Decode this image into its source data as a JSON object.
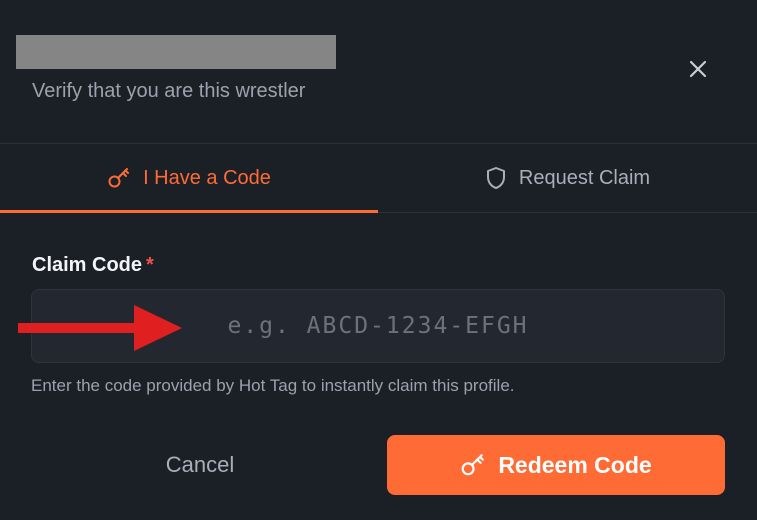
{
  "dialog": {
    "subtitle": "Verify that you are this wrestler",
    "close_icon": "close-icon"
  },
  "tabs": [
    {
      "label": "I Have a Code",
      "icon": "key-icon",
      "active": true
    },
    {
      "label": "Request Claim",
      "icon": "shield-icon",
      "active": false
    }
  ],
  "claim_code": {
    "label": "Claim Code",
    "required_marker": "*",
    "value": "",
    "placeholder": "e.g. ABCD-1234-EFGH",
    "help_text": "Enter the code provided by Hot Tag to instantly claim this profile."
  },
  "actions": {
    "cancel_label": "Cancel",
    "redeem_label": "Redeem Code",
    "redeem_icon": "key-icon"
  },
  "colors": {
    "accent": "#ff6b35",
    "background": "#1b1f26",
    "required": "#f0524a",
    "annotation_arrow": "#e02020"
  }
}
